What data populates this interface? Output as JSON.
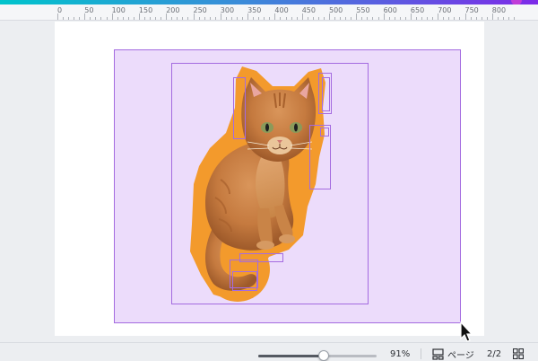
{
  "ruler": {
    "labels": [
      "0",
      "50",
      "100",
      "150",
      "200",
      "250",
      "300",
      "350",
      "400",
      "450",
      "500",
      "550",
      "600",
      "650",
      "700",
      "750",
      "800"
    ]
  },
  "canvas": {
    "object": "cat-cutout",
    "outline_color": "#f39a2c",
    "selection_color": "#a46be0",
    "selection_fill": "#ecdcfb"
  },
  "bottom_bar": {
    "zoom_percent": "91%",
    "zoom_level": 0.55,
    "pages_label": "ページ",
    "page_count": "2/2"
  },
  "icons": {
    "pages": "pages-icon",
    "grid": "grid-view-icon",
    "cursor": "mouse-pointer-icon"
  }
}
